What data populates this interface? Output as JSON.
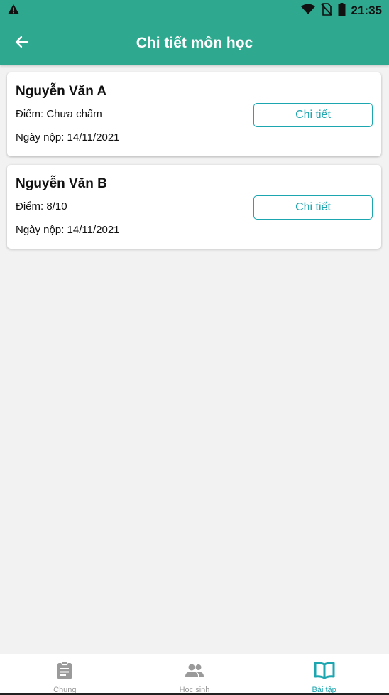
{
  "status_bar": {
    "time": "21:35",
    "icons": [
      "warning-icon",
      "wifi-icon",
      "no-sim-icon",
      "battery-icon"
    ]
  },
  "app_bar": {
    "title": "Chi tiết môn học",
    "back_icon": "arrow-left-icon"
  },
  "submissions": [
    {
      "name": "Nguyễn Văn A",
      "score": "Điểm: Chưa chấm",
      "date": "Ngày nộp: 14/11/2021",
      "button": "Chi tiết"
    },
    {
      "name": "Nguyễn Văn B",
      "score": "Điểm: 8/10",
      "date": "Ngày nộp: 14/11/2021",
      "button": "Chi tiết"
    }
  ],
  "bottom_nav": {
    "items": [
      {
        "label": "Chung",
        "icon": "clipboard-icon",
        "active": false
      },
      {
        "label": "Học sinh",
        "icon": "people-icon",
        "active": false
      },
      {
        "label": "Bài tập",
        "icon": "book-icon",
        "active": true
      }
    ]
  },
  "colors": {
    "primary": "#2ea88e",
    "accent": "#1ba6b0",
    "inactive": "#9a9a9a",
    "background": "#f2f2f2"
  }
}
